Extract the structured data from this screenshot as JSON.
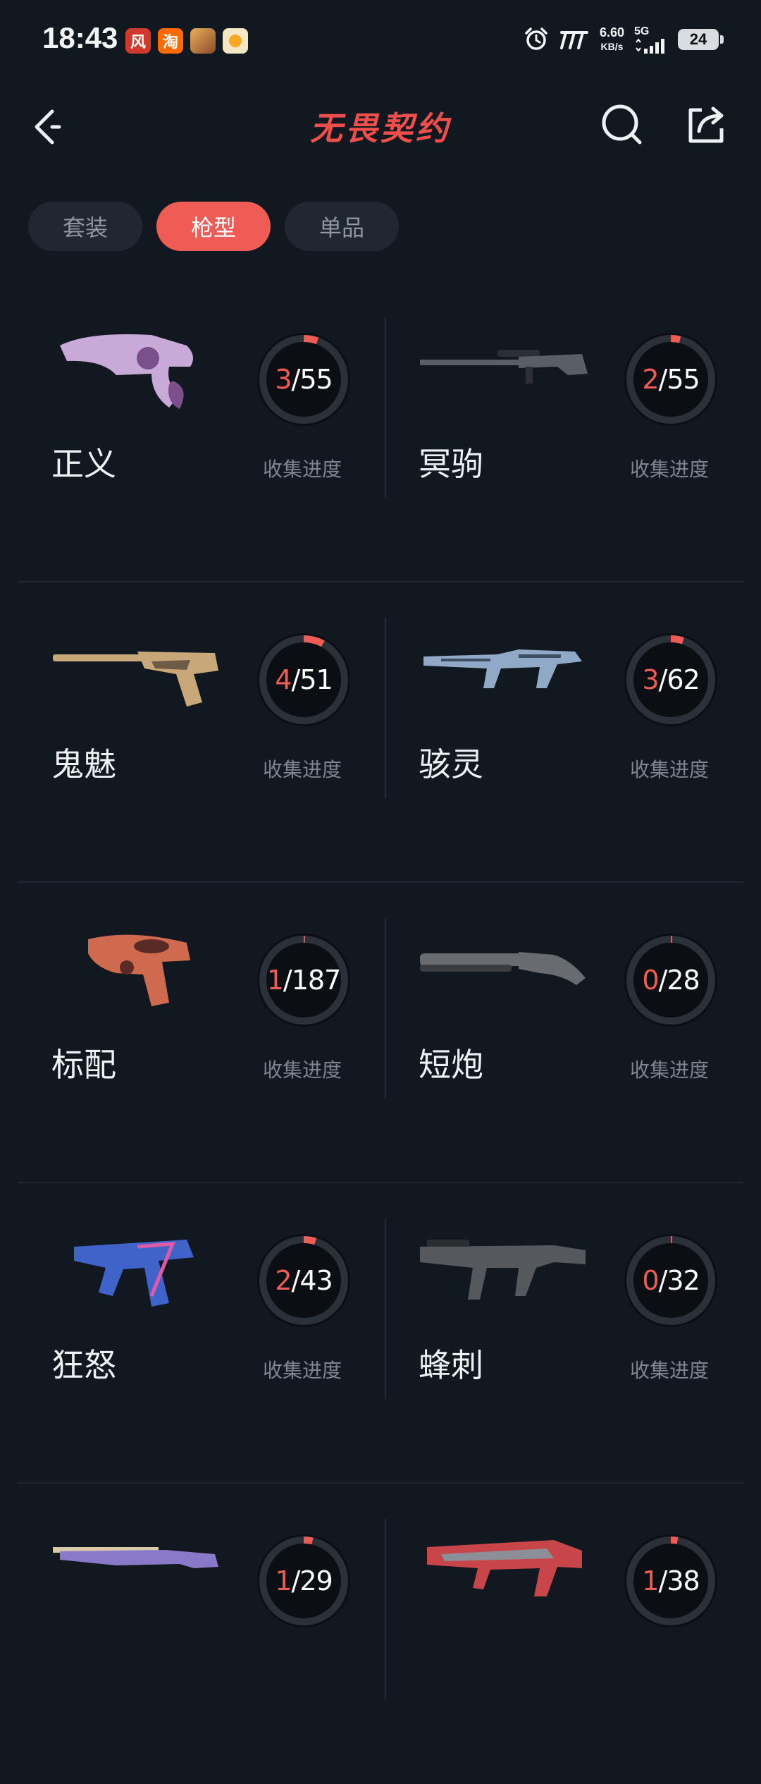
{
  "status_bar": {
    "time": "18:43",
    "app_icons": [
      {
        "name": "wind-app-icon",
        "glyph": "风",
        "color": "#d03a2c"
      },
      {
        "name": "taobao-app-icon",
        "glyph": "淘",
        "color": "#ff6a00"
      },
      {
        "name": "game-app-icon",
        "glyph": "",
        "color": "#c68a3a"
      },
      {
        "name": "orange-app-icon",
        "glyph": "",
        "color": "#f7a823"
      }
    ],
    "net_speed_value": "6.60",
    "net_speed_unit": "KB/s",
    "network": "5G",
    "battery": "24"
  },
  "header": {
    "title": "无畏契约"
  },
  "tabs": [
    {
      "label": "套装",
      "active": false
    },
    {
      "label": "枪型",
      "active": true
    },
    {
      "label": "单品",
      "active": false
    }
  ],
  "progress_label": "收集进度",
  "weapons": [
    {
      "name": "正义",
      "have": "3",
      "total": "55",
      "fraction": 0.0545,
      "style": "revolver",
      "c1": "#c9a9d8",
      "c2": "#7a4f8c"
    },
    {
      "name": "冥驹",
      "have": "2",
      "total": "55",
      "fraction": 0.0364,
      "style": "sniper",
      "c1": "#5a5e66",
      "c2": "#2c2f35"
    },
    {
      "name": "鬼魅",
      "have": "4",
      "total": "51",
      "fraction": 0.0784,
      "style": "pistol-long",
      "c1": "#c8a878",
      "c2": "#6e5a45"
    },
    {
      "name": "骇灵",
      "have": "3",
      "total": "62",
      "fraction": 0.0484,
      "style": "smg",
      "c1": "#8fa9c6",
      "c2": "#3d4e63"
    },
    {
      "name": "标配",
      "have": "1",
      "total": "187",
      "fraction": 0.0053,
      "style": "pistol",
      "c1": "#d06a4e",
      "c2": "#5a2a26"
    },
    {
      "name": "短炮",
      "have": "0",
      "total": "28",
      "fraction": 0,
      "style": "shotgun",
      "c1": "#686b70",
      "c2": "#3a3c40"
    },
    {
      "name": "狂怒",
      "have": "2",
      "total": "43",
      "fraction": 0.0465,
      "style": "frenzy",
      "c1": "#3f63c9",
      "c2": "#e05aa6"
    },
    {
      "name": "蜂刺",
      "have": "0",
      "total": "32",
      "fraction": 0,
      "style": "stinger",
      "c1": "#55585d",
      "c2": "#2b2d31"
    },
    {
      "name": "",
      "have": "1",
      "total": "29",
      "fraction": 0.0345,
      "style": "rifle-long",
      "c1": "#8a78c9",
      "c2": "#d9c9a8"
    },
    {
      "name": "",
      "have": "1",
      "total": "38",
      "fraction": 0.0263,
      "style": "rifle",
      "c1": "#c8454a",
      "c2": "#8d8f98"
    }
  ],
  "colors": {
    "accent": "#ef5c55",
    "background": "#111820",
    "ring_track": "#2a3138",
    "ring_fill": "#ef5c55"
  }
}
